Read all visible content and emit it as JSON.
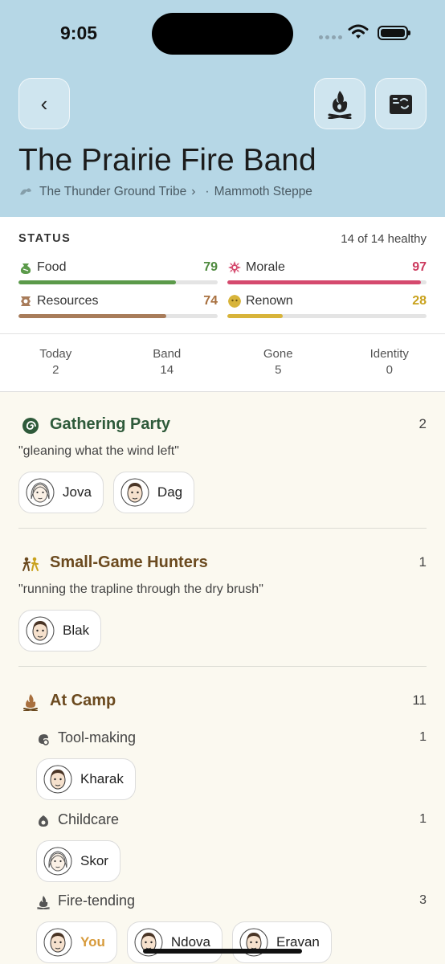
{
  "status_bar": {
    "time": "9:05"
  },
  "header": {
    "back_label": "‹",
    "title": "The Prairie Fire Band",
    "breadcrumb": {
      "tribe": "The Thunder Ground Tribe",
      "chevron": "›",
      "dot": "·",
      "region": "Mammoth Steppe"
    },
    "icons": [
      "campfire-icon",
      "map-scroll-icon"
    ]
  },
  "status": {
    "label": "STATUS",
    "healthy": "14 of 14 healthy",
    "stats": [
      {
        "name": "Food",
        "value": "79",
        "fraction": 0.79,
        "color": "#5b9a4a",
        "value_color": "#4f8a3f",
        "icon": "food-pouch-icon"
      },
      {
        "name": "Morale",
        "value": "97",
        "fraction": 0.97,
        "color": "#d54a6e",
        "value_color": "#cc3a5e",
        "icon": "morale-flower-icon"
      },
      {
        "name": "Resources",
        "value": "74",
        "fraction": 0.74,
        "color": "#a87c5a",
        "value_color": "#a8703f",
        "icon": "resources-icon"
      },
      {
        "name": "Renown",
        "value": "28",
        "fraction": 0.28,
        "color": "#d8b43a",
        "value_color": "#c9a21d",
        "icon": "renown-icon"
      }
    ]
  },
  "tabs": [
    {
      "label": "Today",
      "count": "2",
      "active": true
    },
    {
      "label": "Band",
      "count": "14",
      "active": false
    },
    {
      "label": "Gone",
      "count": "5",
      "active": false
    },
    {
      "label": "Identity",
      "count": "0",
      "active": false
    }
  ],
  "groups": {
    "gathering": {
      "title": "Gathering Party",
      "count": "2",
      "title_color": "#2e5a3a",
      "quote": "\"gleaning what the wind left\"",
      "icon": "spiral-icon",
      "members": [
        "Jova",
        "Dag"
      ]
    },
    "hunters": {
      "title": "Small-Game Hunters",
      "count": "1",
      "title_color": "#6b4a1f",
      "quote": "\"running the trapline through the dry brush\"",
      "icon": "hunters-icon",
      "members": [
        "Blak"
      ]
    },
    "camp": {
      "title": "At Camp",
      "count": "11",
      "title_color": "#6b4a1f",
      "icon": "campfire-icon",
      "subgroups": [
        {
          "title": "Tool-making",
          "count": "1",
          "icon": "tool-icon",
          "members": [
            "Kharak"
          ]
        },
        {
          "title": "Childcare",
          "count": "1",
          "icon": "childcare-icon",
          "members": [
            "Skor"
          ]
        },
        {
          "title": "Fire-tending",
          "count": "3",
          "icon": "fire-icon",
          "members": [
            "You",
            "Ndova",
            "Eravan"
          ]
        }
      ]
    }
  }
}
